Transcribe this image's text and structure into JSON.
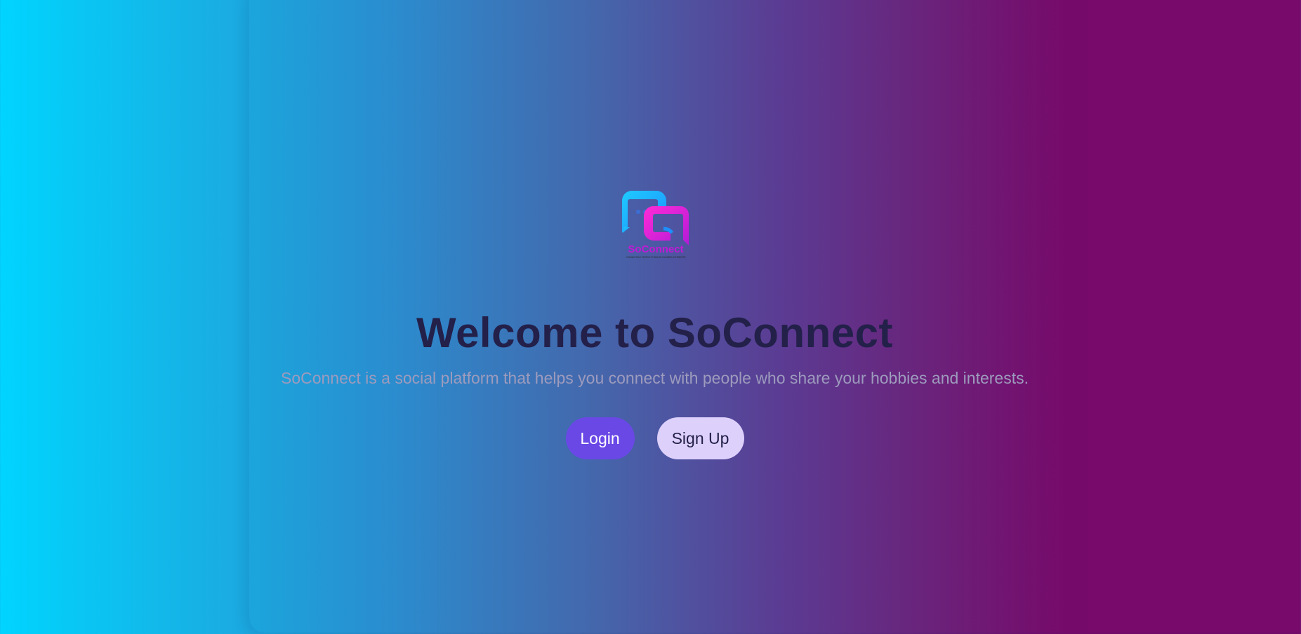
{
  "logo": {
    "icon": "chat-bubbles-logo",
    "brand_text": "SoConnect",
    "tagline": "CONNECTING PEOPLE THROUGH SHARED INTERESTS",
    "colors": {
      "blue": "#19a9ff",
      "pink": "#e91ee0"
    }
  },
  "hero": {
    "title": "Welcome to SoConnect",
    "subtitle": "SoConnect is a social platform that helps you connect with people who share your hobbies and interests."
  },
  "actions": {
    "login_label": "Login",
    "signup_label": "Sign Up"
  },
  "colors": {
    "background_start": "#00d4ff",
    "background_end": "#770a6b",
    "title": "#23204a",
    "subtitle": "#9d9bbd",
    "login_bg": "#6a48e6",
    "signup_bg": "#ddd0fb"
  }
}
